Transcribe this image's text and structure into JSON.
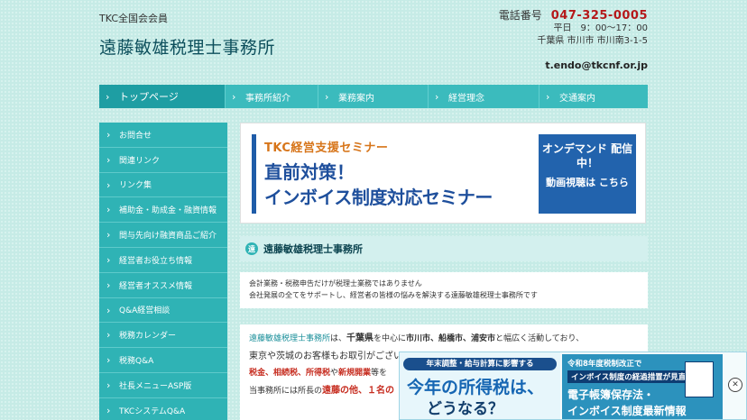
{
  "header": {
    "member": "TKC全国会会員",
    "title": "遠藤敏雄税理士事務所",
    "tel_label": "電話番号",
    "tel": "047-325-0005",
    "hours": "平日　9：00〜17：00",
    "address": "千葉県 市川市 市川南3-1-5",
    "email": "t.endo@tkcnf.or.jp"
  },
  "gnav": [
    {
      "label": "トップページ",
      "active": true
    },
    {
      "label": "事務所紹介"
    },
    {
      "label": "業務案内"
    },
    {
      "label": "経営理念"
    },
    {
      "label": "交通案内"
    }
  ],
  "sidebar": [
    {
      "label": "お問合せ"
    },
    {
      "label": "関連リンク"
    },
    {
      "label": "リンク集"
    },
    {
      "label": "補助金・助成金・融資情報"
    },
    {
      "label": "間与先向け融資商品ご紹介"
    },
    {
      "label": "経営者お役立ち情報"
    },
    {
      "label": "経営者オススメ情報"
    },
    {
      "label": "Q&A経営相談"
    },
    {
      "label": "税務カレンダー"
    },
    {
      "label": "税務Q&A"
    },
    {
      "label": "社長メニューASP版"
    },
    {
      "label": "TKCシステムQ&A"
    }
  ],
  "banner": {
    "line1": "TKC経営支援セミナー",
    "line2": "直前対策！",
    "line3": "インボイス制度対応セミナー",
    "od1": "オンデマンド 配信中！",
    "od2": "動画視聴は こちら"
  },
  "section": {
    "icon": "遠",
    "title": "遠藤敏雄税理士事務所"
  },
  "intro": {
    "line1": "会計業務・税務申告だけが税理士業務ではありません",
    "line2": "会社発展の全てをサポートし、経営者の皆様の悩みを解決する遠藤敏雄税理士事務所です"
  },
  "body": {
    "name": "遠藤敏雄税理士事務所",
    "p1a": "は、",
    "p1b": "千葉県",
    "p1c": "を中心に",
    "p1d": "市川市、船橋市、浦安市",
    "p1e": "と幅広く活動しており、",
    "p2": "東京や茨城のお客様もお取引がござい",
    "p3a": "税金、相続税、所得税",
    "p3b": "や",
    "p3c": "新規開業",
    "p3d": "等を",
    "p4a": "当事務所には所長の",
    "p4b": "遠藤の他、１名の"
  },
  "ad": {
    "pill": "年末調整・給与計算に影響する",
    "big": "今年の所得税は、",
    "sub": "どうなる？",
    "r1": "令和8年度税制改正で",
    "r2": "インボイス制度の経過措置が見直し",
    "r3": "電子帳簿保存法・",
    "r4": "インボイス制度最新情報",
    "close": "✕"
  }
}
